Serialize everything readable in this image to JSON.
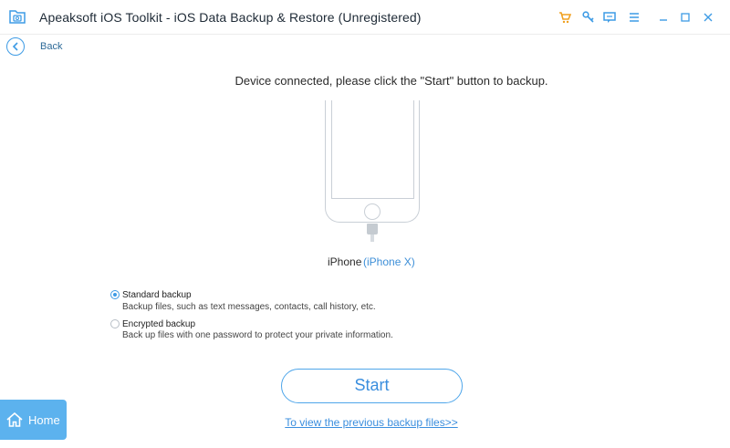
{
  "app": {
    "title": "Apeaksoft iOS Toolkit - iOS Data Backup & Restore (Unregistered)"
  },
  "titlebar": {
    "icons": [
      "cart-icon",
      "key-icon",
      "feedback-icon",
      "menu-icon",
      "minimize-icon",
      "maximize-icon",
      "close-icon"
    ],
    "accent_color": "#f0a020"
  },
  "nav": {
    "back_label": "Back"
  },
  "main": {
    "instruction": "Device connected, please click the \"Start\" button to backup.",
    "device": {
      "name": "iPhone",
      "model": "(iPhone X)"
    },
    "options": [
      {
        "title": "Standard backup",
        "description": "Backup files, such as text messages, contacts, call history, etc.",
        "selected": true
      },
      {
        "title": "Encrypted backup",
        "description": "Back up files with one password to protect your private information.",
        "selected": false
      }
    ],
    "start_label": "Start",
    "previous_link": "To view the previous backup files>>"
  },
  "home": {
    "label": "Home"
  },
  "colors": {
    "primary": "#3d9be5",
    "home_bg": "#5cb2ee"
  }
}
